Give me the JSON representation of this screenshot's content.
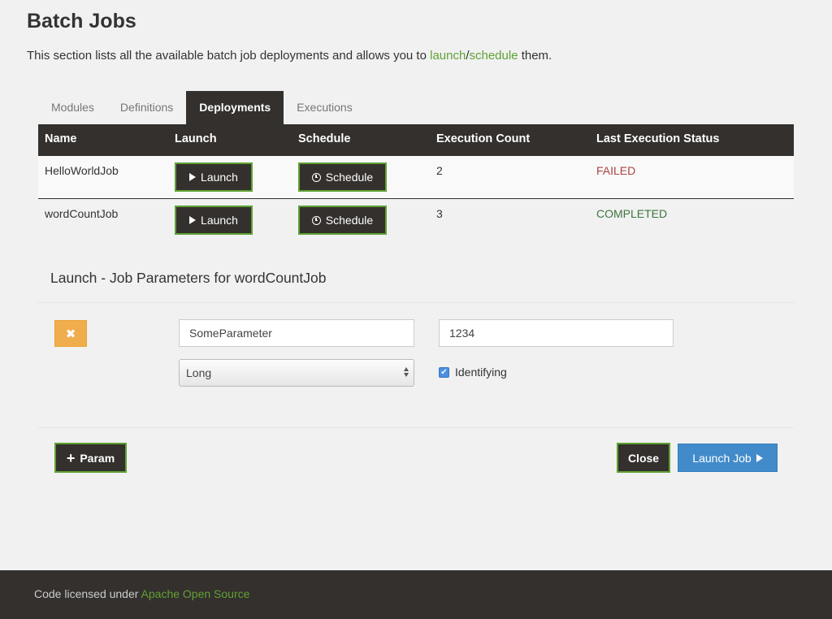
{
  "page": {
    "title": "Batch Jobs",
    "intro_prefix": "This section lists all the available batch job deployments and allows you to ",
    "intro_link1": "launch",
    "intro_sep": "/",
    "intro_link2": "schedule",
    "intro_suffix": " them."
  },
  "tabs": [
    {
      "label": "Modules",
      "active": false
    },
    {
      "label": "Definitions",
      "active": false
    },
    {
      "label": "Deployments",
      "active": true
    },
    {
      "label": "Executions",
      "active": false
    }
  ],
  "table": {
    "headers": [
      "Name",
      "Launch",
      "Schedule",
      "Execution Count",
      "Last Execution Status"
    ],
    "rows": [
      {
        "name": "HelloWorldJob",
        "launch_label": "Launch",
        "schedule_label": "Schedule",
        "count": "2",
        "status": "FAILED"
      },
      {
        "name": "wordCountJob",
        "launch_label": "Launch",
        "schedule_label": "Schedule",
        "count": "3",
        "status": "COMPLETED"
      }
    ]
  },
  "params": {
    "title": "Launch - Job Parameters for wordCountJob",
    "name_value": "SomeParameter",
    "value_value": "1234",
    "type_selected": "Long",
    "identifying_label": "Identifying",
    "identifying_checked": true
  },
  "actions": {
    "add_param_label": "Param",
    "close_label": "Close",
    "launch_job_label": "Launch Job"
  },
  "footer": {
    "prefix": "Code licensed under ",
    "link": "Apache Open Source"
  },
  "colors": {
    "accent_green": "#5fa134",
    "dark": "#34302d",
    "primary_blue": "#428bca",
    "warning_orange": "#f0ad4e",
    "failed_red": "#a94442",
    "completed_green": "#3c763d"
  },
  "icons": [
    "play-icon",
    "clock-icon",
    "close-icon",
    "plus-icon",
    "chevron-updown-icon",
    "check-icon"
  ]
}
